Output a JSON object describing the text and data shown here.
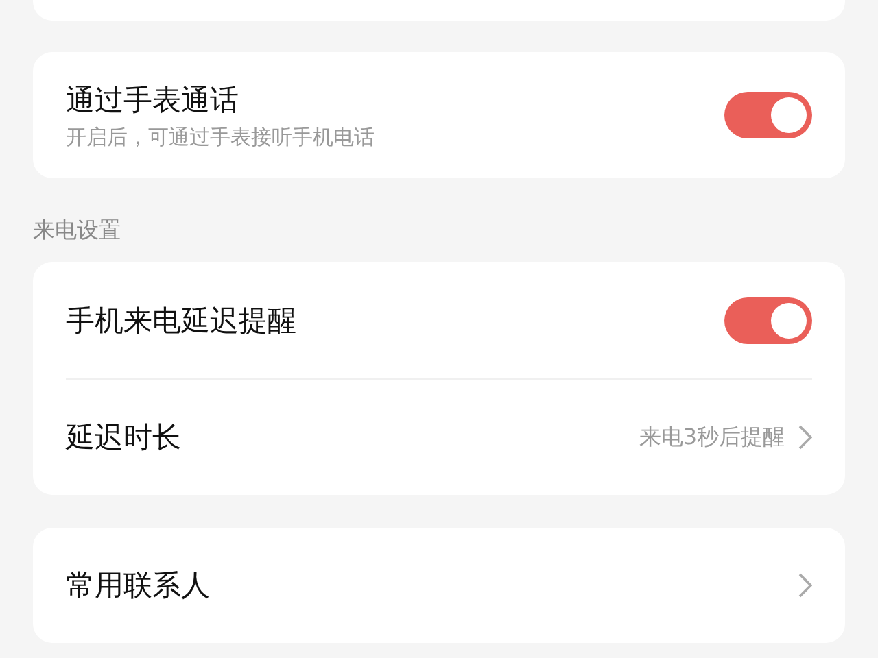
{
  "watch_call": {
    "title": "通过手表通话",
    "subtitle": "开启后，可通过手表接听手机电话",
    "on": true
  },
  "section_label": "来电设置",
  "call_settings": [
    {
      "kind": "toggle",
      "title": "手机来电延迟提醒",
      "on": true
    },
    {
      "kind": "link",
      "title": "延迟时长",
      "value": "来电3秒后提醒"
    }
  ],
  "contacts": {
    "title": "常用联系人"
  }
}
